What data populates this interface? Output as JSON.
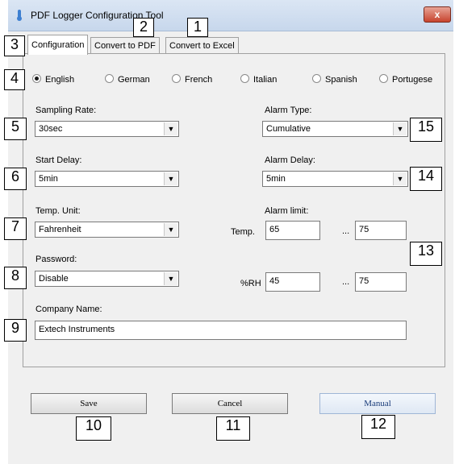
{
  "window": {
    "title": "PDF Logger Configuration Tool",
    "close_label": "x"
  },
  "tabs": [
    {
      "label": "Configuration"
    },
    {
      "label": "Convert to PDF"
    },
    {
      "label": "Convert to Excel"
    }
  ],
  "languages": [
    {
      "label": "English",
      "selected": true
    },
    {
      "label": "German",
      "selected": false
    },
    {
      "label": "French",
      "selected": false
    },
    {
      "label": "Italian",
      "selected": false
    },
    {
      "label": "Spanish",
      "selected": false
    },
    {
      "label": "Portugese",
      "selected": false
    }
  ],
  "fields": {
    "sampling_rate": {
      "label": "Sampling Rate:",
      "value": "30sec"
    },
    "start_delay": {
      "label": "Start Delay:",
      "value": "5min"
    },
    "temp_unit": {
      "label": "Temp. Unit:",
      "value": "Fahrenheit"
    },
    "password": {
      "label": "Password:",
      "value": "Disable"
    },
    "company_name": {
      "label": "Company Name:",
      "value": "Extech Instruments"
    },
    "alarm_type": {
      "label": "Alarm Type:",
      "value": "Cumulative"
    },
    "alarm_delay": {
      "label": "Alarm Delay:",
      "value": "5min"
    },
    "alarm_limit": {
      "label": "Alarm limit:",
      "temp_label": "Temp.",
      "temp_low": "65",
      "temp_high": "75",
      "rh_label": "%RH",
      "rh_low": "45",
      "rh_high": "75",
      "range_sep": "..."
    }
  },
  "buttons": {
    "save": "Save",
    "cancel": "Cancel",
    "manual": "Manual"
  },
  "callouts": [
    "1",
    "2",
    "3",
    "4",
    "5",
    "6",
    "7",
    "8",
    "9",
    "10",
    "11",
    "12",
    "13",
    "14",
    "15"
  ],
  "colors": {
    "title_bar": "#c7d7ec",
    "close_button": "#c7442e",
    "manual_text": "#1a3c7a"
  }
}
